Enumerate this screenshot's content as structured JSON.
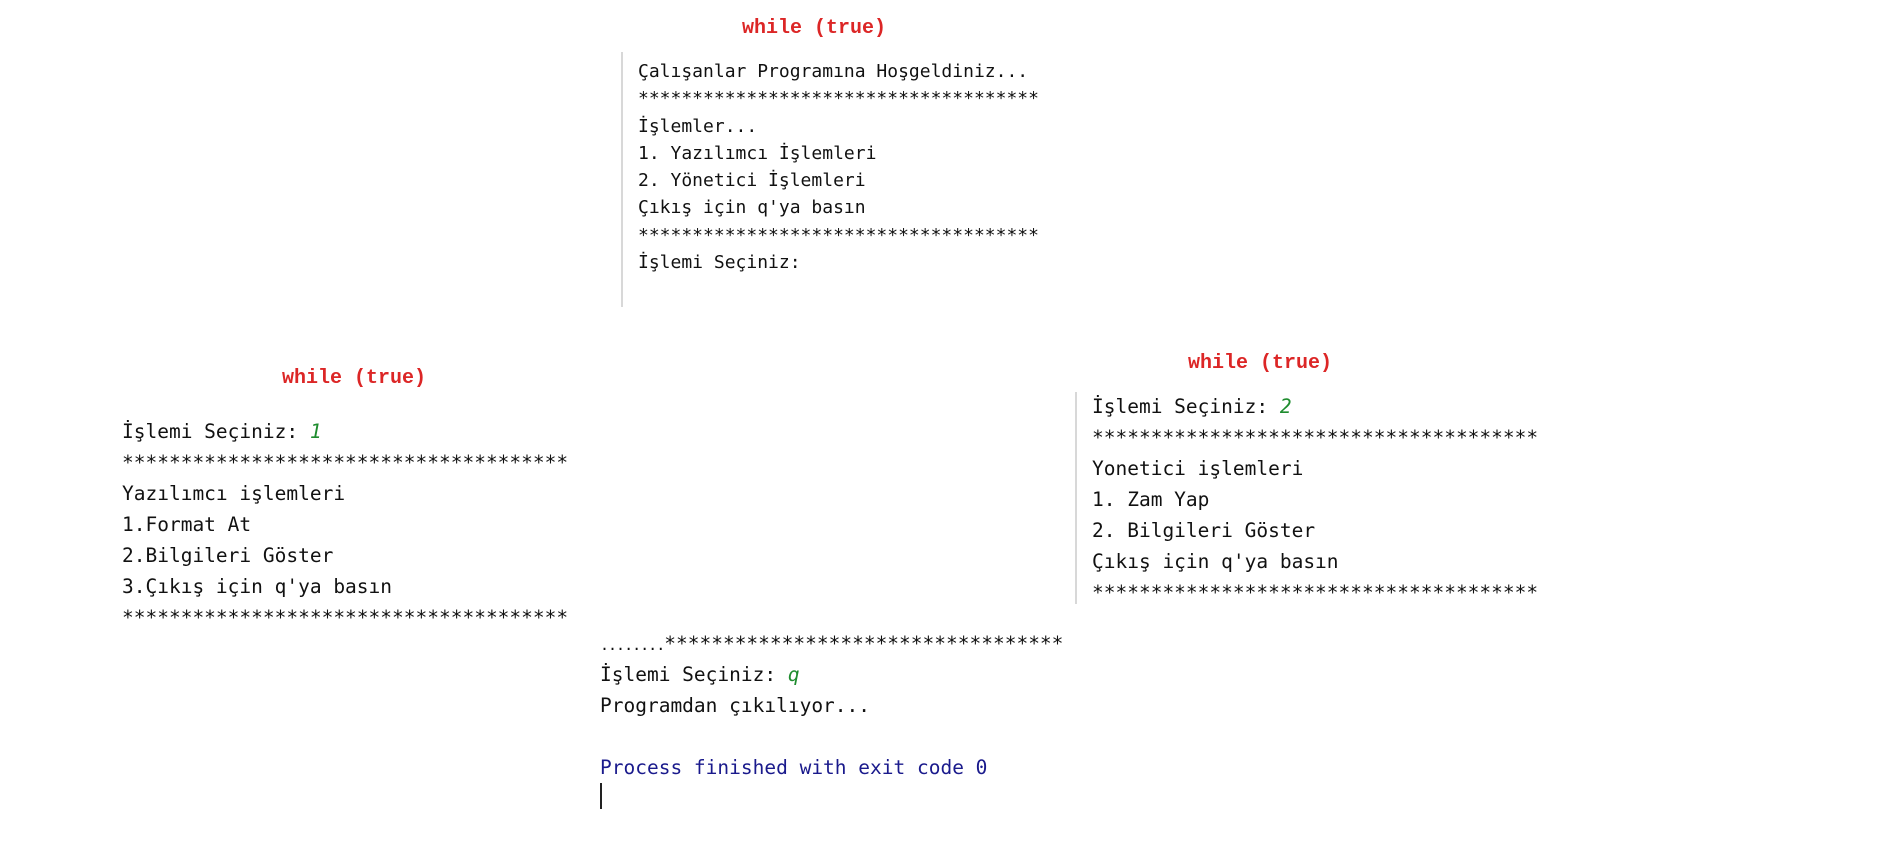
{
  "colors": {
    "heading": "#dc2626",
    "input_value": "#1e8c2e",
    "process_text": "#1a1a8c",
    "panel_rule": "#d8d8d8"
  },
  "top_panel": {
    "heading": "while (true)",
    "lines": [
      "Çalışanlar Programına Hoşgeldiniz...",
      "*************************************",
      "İşlemler...",
      "1. Yazılımcı İşlemleri",
      "2. Yönetici İşlemleri",
      "Çıkış için q'ya basın",
      "*************************************",
      "İşlemi Seçiniz:"
    ]
  },
  "left_panel": {
    "heading": "while (true)",
    "prompt_label": "İşlemi Seçiniz: ",
    "prompt_value": "1",
    "lines": [
      "**************************************",
      "Yazılımcı işlemleri",
      "1.Format At",
      "2.Bilgileri Göster",
      "3.Çıkış için q'ya basın",
      "**************************************"
    ]
  },
  "right_panel": {
    "heading": "while (true)",
    "prompt_label": "İşlemi Seçiniz: ",
    "prompt_value": "2",
    "lines": [
      "**************************************",
      "Yonetici işlemleri",
      "1. Zam Yap",
      "2. Bilgileri Göster",
      "Çıkış için q'ya basın",
      "**************************************"
    ]
  },
  "bottom_panel": {
    "dots": "........",
    "stars": "**********************************",
    "prompt_label": "İşlemi Seçiniz: ",
    "prompt_value": "q",
    "exit_message": "Programdan çıkılıyor...",
    "process_message": "Process finished with exit code 0"
  }
}
